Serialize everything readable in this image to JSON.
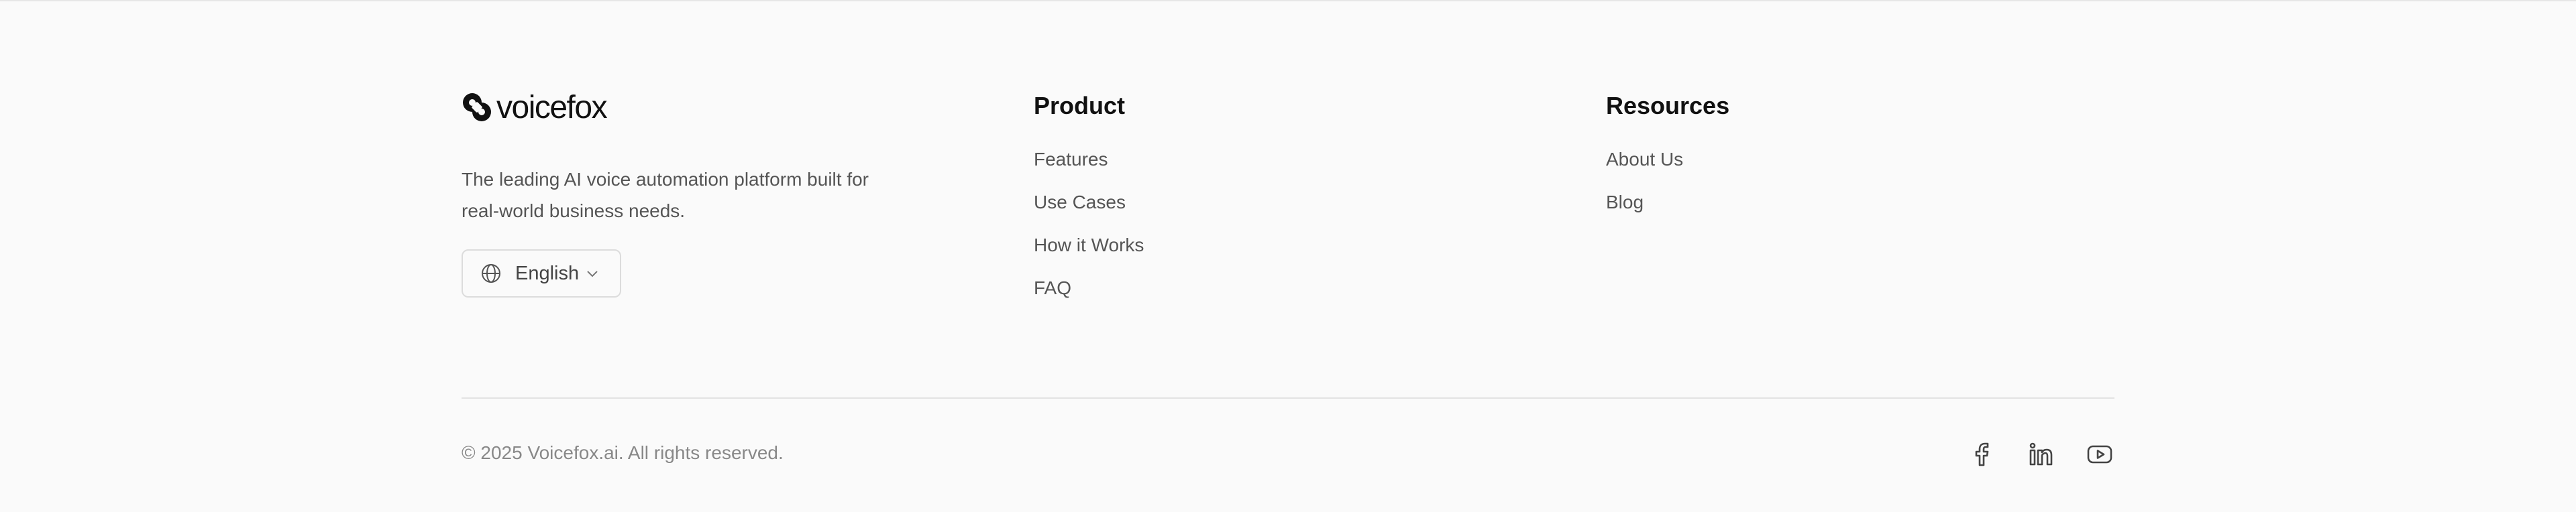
{
  "brand": {
    "name": "voicefox",
    "tagline": "The leading AI voice automation platform built for real-world business needs.",
    "language": "English"
  },
  "product": {
    "heading": "Product",
    "links": [
      "Features",
      "Use Cases",
      "How it Works",
      "FAQ"
    ]
  },
  "resources": {
    "heading": "Resources",
    "links": [
      "About Us",
      "Blog"
    ]
  },
  "footer": {
    "copyright": "© 2025 Voicefox.ai. All rights reserved."
  },
  "social": [
    {
      "icon": "facebook-icon"
    },
    {
      "icon": "linkedin-icon"
    },
    {
      "icon": "youtube-icon"
    }
  ],
  "colors": {
    "background": "#fafafa",
    "text_primary": "#111111",
    "text_secondary": "#555555",
    "text_muted": "#888888",
    "border": "#dcdcdc"
  }
}
